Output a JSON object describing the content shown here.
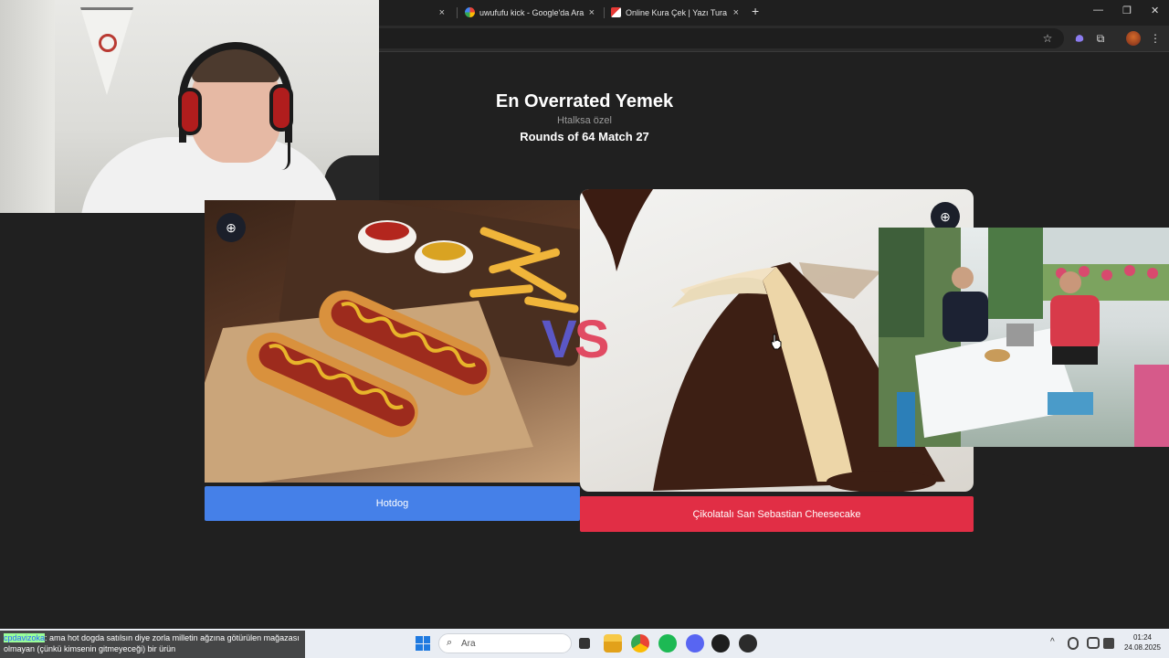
{
  "browser": {
    "tabs": [
      {
        "title": "",
        "close": "×"
      },
      {
        "title": "uwufufu kick - Google'da Ara",
        "close": "×"
      },
      {
        "title": "Online Kura Çek | Yazı Tura",
        "close": "×"
      }
    ],
    "new_tab": "+",
    "window_controls": {
      "minimize": "—",
      "restore": "❐",
      "close": "✕"
    },
    "toolbar_icons": {
      "bookmark": "☆",
      "extensions": "⧉",
      "menu": "⋮"
    }
  },
  "page": {
    "title": "En Overrated Yemek",
    "subtitle": "Htalksa özel",
    "round_label": "Rounds of 64 Match 27",
    "vs": {
      "v": "V",
      "s": "S"
    },
    "left_choice": {
      "label": "Hotdog",
      "color": "#4580e8"
    },
    "right_choice": {
      "label": "Çikolatalı San Sebastian Cheesecake",
      "color": "#e12e45"
    },
    "zoom_icon": "⊕"
  },
  "chat": {
    "username": "cpdavizoka",
    "message": ": ama hot dogda satılsın diye zorla milletin ağzına götürülen mağazası olmayan (çünkü kimsenin gitmeyeceği) bir ürün"
  },
  "taskbar": {
    "search_placeholder": "Ara",
    "search_icon": "⌕",
    "tray_chevron": "^",
    "time": "01:24",
    "date": "24.08.2025"
  }
}
